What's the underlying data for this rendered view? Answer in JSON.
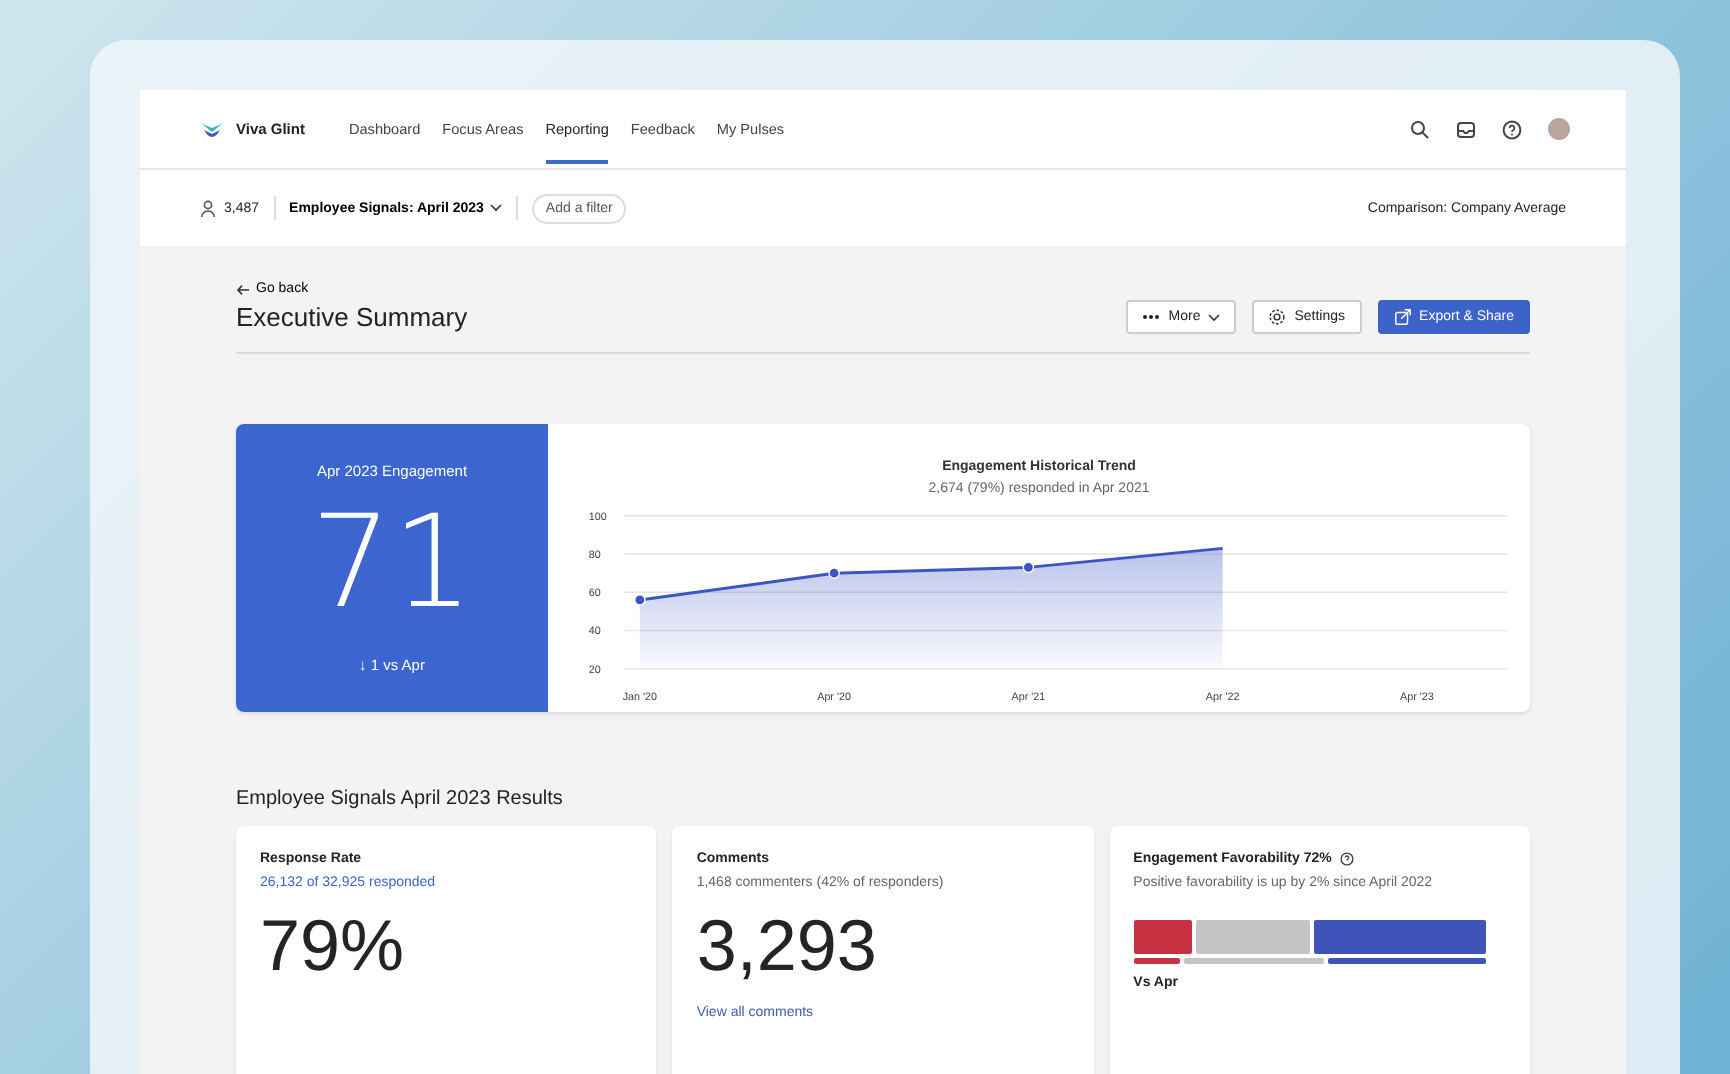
{
  "app": {
    "name": "Viva Glint"
  },
  "nav": [
    {
      "label": "Dashboard",
      "selected": false
    },
    {
      "label": "Focus Areas",
      "selected": false
    },
    {
      "label": "Reporting",
      "selected": true
    },
    {
      "label": "Feedback",
      "selected": false
    },
    {
      "label": "My Pulses",
      "selected": false
    }
  ],
  "filter_bar": {
    "population": "3,487",
    "survey": "Employee Signals: April 2023",
    "add_filter": "Add a filter",
    "comparison": "Comparison: Company Average"
  },
  "header": {
    "back": "Go back",
    "title": "Executive Summary",
    "buttons": [
      {
        "kind": "more",
        "label": "More"
      },
      {
        "kind": "settings",
        "label": "Settings"
      },
      {
        "kind": "export",
        "label": "Export & Share"
      }
    ]
  },
  "engagement": {
    "title": "Apr 2023 Engagement",
    "score": "71",
    "change": "↓ 1 vs Apr"
  },
  "trend": {
    "title": "Engagement Historical Trend",
    "subtitle": "2,674 (79%) responded in Apr 2021",
    "chart_data": {
      "type": "area",
      "categories": [
        "Jan '20",
        "Apr '20",
        "Apr '21",
        "Apr '22",
        "Apr '23"
      ],
      "series": [
        {
          "color": "#3b56c4",
          "values": [
            56,
            70,
            73,
            83,
            null
          ]
        }
      ],
      "ylim": [
        20,
        100
      ],
      "yticks": [
        20,
        40,
        60,
        80,
        100
      ],
      "grid": true
    }
  },
  "section_title": "Employee Signals April 2023 Results",
  "cards": [
    {
      "kind": "response",
      "title": "Response Rate",
      "subtitle": "26,132 of 32,925 responded",
      "value": "79%"
    },
    {
      "kind": "comments",
      "title": "Comments",
      "subtitle": "1,468 commenters (42% of responders)",
      "value": "3,293",
      "link": "View all comments"
    },
    {
      "kind": "favorability",
      "title": "Engagement Favorability 72%",
      "subtitle": "Positive favorability is up by 2% since April 2022",
      "label": "Vs Apr"
    }
  ]
}
